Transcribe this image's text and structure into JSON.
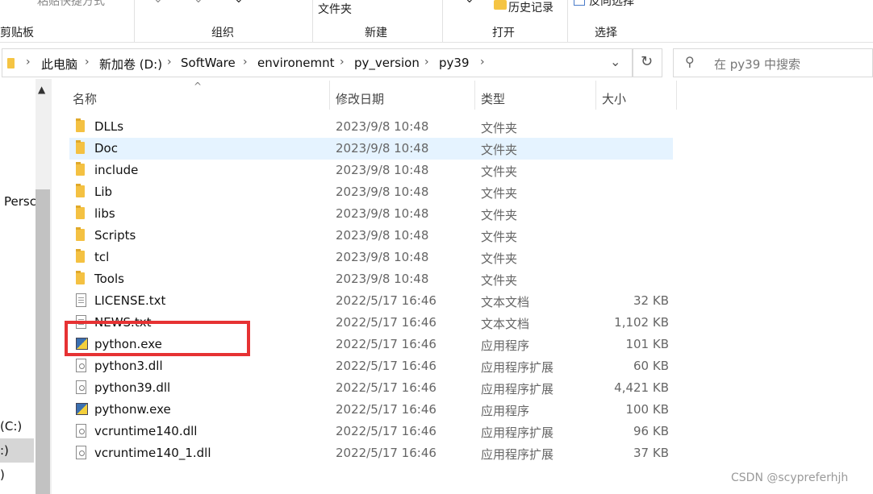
{
  "ribbon": {
    "paste_shortcut_label": "粘贴快捷方式",
    "folder_label": "文件夹",
    "history_label": "历史记录",
    "invert_select_label": "反向选择",
    "groups": [
      "剪贴板",
      "组织",
      "新建",
      "打开",
      "选择"
    ]
  },
  "address": {
    "crumbs": [
      "此电脑",
      "新加卷 (D:)",
      "SoftWare",
      "environemnt",
      "py_version",
      "py39"
    ]
  },
  "search": {
    "placeholder": "在 py39 中搜索"
  },
  "nav": {
    "items": [
      "Persc",
      "(C:)",
      ":)",
      ")"
    ]
  },
  "columns": {
    "name": "名称",
    "date": "修改日期",
    "type": "类型",
    "size": "大小"
  },
  "files": [
    {
      "name": "DLLs",
      "date": "2023/9/8 10:48",
      "type": "文件夹",
      "size": "",
      "icon": "folder-icon"
    },
    {
      "name": "Doc",
      "date": "2023/9/8 10:48",
      "type": "文件夹",
      "size": "",
      "icon": "folder-icon"
    },
    {
      "name": "include",
      "date": "2023/9/8 10:48",
      "type": "文件夹",
      "size": "",
      "icon": "folder-icon"
    },
    {
      "name": "Lib",
      "date": "2023/9/8 10:48",
      "type": "文件夹",
      "size": "",
      "icon": "folder-icon"
    },
    {
      "name": "libs",
      "date": "2023/9/8 10:48",
      "type": "文件夹",
      "size": "",
      "icon": "folder-icon"
    },
    {
      "name": "Scripts",
      "date": "2023/9/8 10:48",
      "type": "文件夹",
      "size": "",
      "icon": "folder-icon"
    },
    {
      "name": "tcl",
      "date": "2023/9/8 10:48",
      "type": "文件夹",
      "size": "",
      "icon": "folder-icon"
    },
    {
      "name": "Tools",
      "date": "2023/9/8 10:48",
      "type": "文件夹",
      "size": "",
      "icon": "folder-icon"
    },
    {
      "name": "LICENSE.txt",
      "date": "2022/5/17 16:46",
      "type": "文本文档",
      "size": "32 KB",
      "icon": "text-file-icon"
    },
    {
      "name": "NEWS.txt",
      "date": "2022/5/17 16:46",
      "type": "文本文档",
      "size": "1,102 KB",
      "icon": "text-file-icon"
    },
    {
      "name": "python.exe",
      "date": "2022/5/17 16:46",
      "type": "应用程序",
      "size": "101 KB",
      "icon": "python-exe-icon"
    },
    {
      "name": "python3.dll",
      "date": "2022/5/17 16:46",
      "type": "应用程序扩展",
      "size": "60 KB",
      "icon": "dll-file-icon"
    },
    {
      "name": "python39.dll",
      "date": "2022/5/17 16:46",
      "type": "应用程序扩展",
      "size": "4,421 KB",
      "icon": "dll-file-icon"
    },
    {
      "name": "pythonw.exe",
      "date": "2022/5/17 16:46",
      "type": "应用程序",
      "size": "100 KB",
      "icon": "python-exe-icon"
    },
    {
      "name": "vcruntime140.dll",
      "date": "2022/5/17 16:46",
      "type": "应用程序扩展",
      "size": "96 KB",
      "icon": "dll-file-icon"
    },
    {
      "name": "vcruntime140_1.dll",
      "date": "2022/5/17 16:46",
      "type": "应用程序扩展",
      "size": "37 KB",
      "icon": "dll-file-icon"
    }
  ],
  "selected_index": 1,
  "colors": {
    "selection": "#e5f3ff",
    "highlight_box": "#e63233",
    "folder": "#f4c142"
  },
  "watermark": "CSDN @scypreferhjh"
}
